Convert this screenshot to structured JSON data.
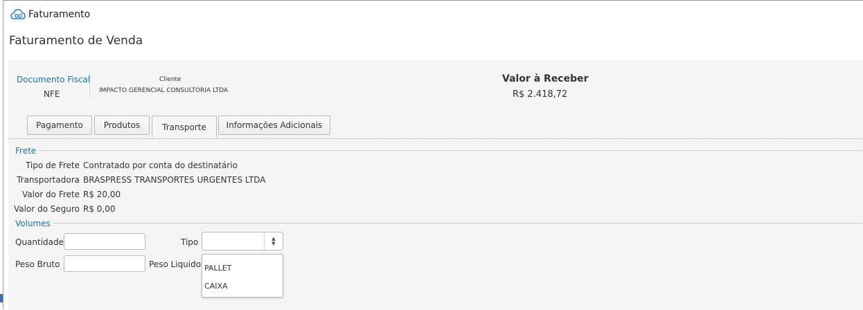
{
  "window": {
    "title": "Faturamento",
    "icon": "cloud-icon"
  },
  "page": {
    "title": "Faturamento de Venda"
  },
  "header": {
    "documento_fiscal_label": "Documento Fiscal",
    "documento_fiscal_value": "NFE",
    "cliente_label": "Cliente",
    "cliente_value": "IMPACTO GERENCIAL CONSULTORIA LTDA",
    "valor_label": "Valor à Receber",
    "valor_value": "R$ 2.418,72"
  },
  "tabs": [
    {
      "label": "Pagamento"
    },
    {
      "label": "Produtos"
    },
    {
      "label": "Transporte",
      "active": true
    },
    {
      "label": "Informações Adicionais"
    }
  ],
  "frete": {
    "title": "Frete",
    "rows": [
      {
        "label": "Tipo de Frete",
        "value": "Contratado por conta do destinatário"
      },
      {
        "label": "Transportadora",
        "value": "BRASPRESS TRANSPORTES URGENTES LTDA"
      },
      {
        "label": "Valor do Frete",
        "value": "R$ 20,00"
      },
      {
        "label": "Valor do Seguro",
        "value": "R$ 0,00"
      }
    ]
  },
  "volumes": {
    "title": "Volumes",
    "quantidade_label": "Quantidade",
    "quantidade_value": "",
    "tipo_label": "Tipo",
    "tipo_selected": "",
    "tipo_options": [
      "PALLET",
      "CAIXA"
    ],
    "peso_bruto_label": "Peso Bruto",
    "peso_bruto_value": "",
    "peso_liquido_label": "Peso Liquido"
  },
  "colors": {
    "accent": "#1f6fb5",
    "panel_bg": "#f5f5f5"
  }
}
